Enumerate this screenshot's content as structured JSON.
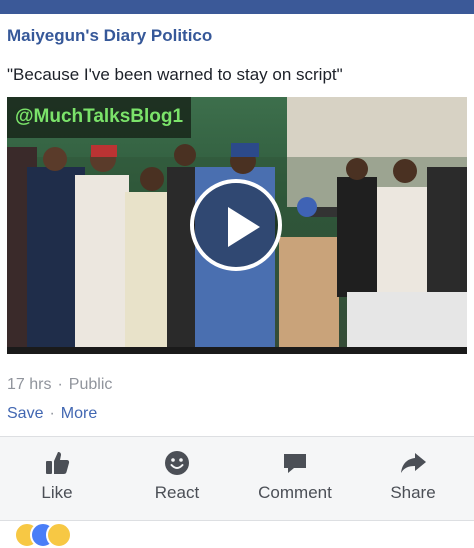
{
  "post": {
    "author": "Maiyegun's  Diary Politico",
    "text": "\"Because I've been warned to stay on script\"",
    "video": {
      "watermark": "@MuchTalksBlog1"
    },
    "time": "17 hrs",
    "privacy": "Public",
    "save_label": "Save",
    "more_label": "More",
    "separator": "·"
  },
  "actions": [
    {
      "label": "Like",
      "icon": "thumbs-up-icon"
    },
    {
      "label": "React",
      "icon": "smiley-icon"
    },
    {
      "label": "Comment",
      "icon": "speech-bubble-icon"
    },
    {
      "label": "Share",
      "icon": "share-arrow-icon"
    }
  ],
  "colors": {
    "brand_bar": "#3b5998",
    "author_link": "#365899",
    "link": "#4267b2",
    "muted": "#90949c",
    "action_bar_bg": "#f5f6f7",
    "watermark_text": "#7be36a"
  }
}
